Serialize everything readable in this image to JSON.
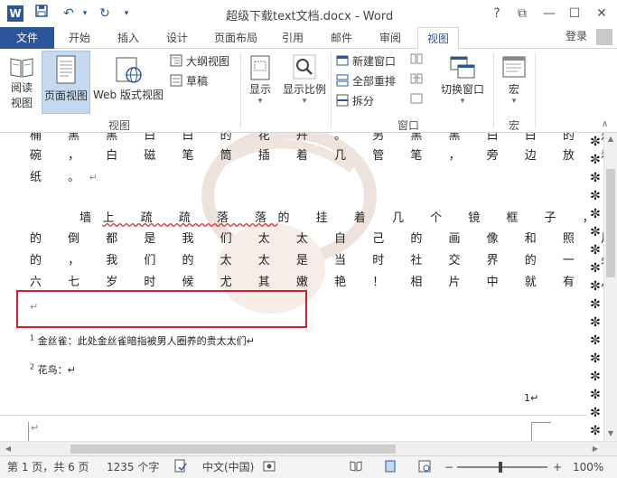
{
  "titlebar": {
    "title": "超级下载text文档.docx - Word",
    "app_icon": "W",
    "help": "?",
    "restore": "⧉",
    "minimize": "—",
    "maximize": "☐",
    "close": "✕"
  },
  "tabs": {
    "file": "文件",
    "items": [
      "开始",
      "插入",
      "设计",
      "页面布局",
      "引用",
      "邮件",
      "审阅",
      "视图"
    ],
    "active": "视图",
    "login": "登录"
  },
  "ribbon": {
    "views": {
      "read_mode_l1": "阅读",
      "read_mode_l2": "视图",
      "print_layout": "页面视图",
      "web_layout": "Web 版式视图",
      "outline": "大纲视图",
      "draft": "草稿",
      "group_label": "视图"
    },
    "show": {
      "label": "显示"
    },
    "zoom": {
      "label": "显示比例"
    },
    "window": {
      "new_window": "新建窗口",
      "arrange_all": "全部重排",
      "split": "拆分",
      "switch_windows": "切换窗口",
      "group_label": "窗口"
    },
    "macros": {
      "label": "宏",
      "group_label": "宏"
    }
  },
  "document": {
    "line_top": "桶 黑 黑 白 白 的 花 卉 。 另 黑 黑 白 白 的 是 一 只 大 墨",
    "line1": "碗 ， 白 磁 笔 筒 插 着 几 管 笔 ， 旁 边 放 着 几 卷 白",
    "line2": "纸 。",
    "para2_prefix": "墙",
    "para2_squig1": "上 疏 疏 落 落",
    "para2_rest": "的 挂 着 几 个 镜 框 子 ， 大 多 数",
    "line3": "的 倒 都 是 我 们 太 太 自 己 的 画 像 和 照 片 。 无 疑",
    "line4": "的 ， 我 们 的 太 太 是 当 时 社 交 界 的 一 朵 名 花 ， 十",
    "line5": "六 七 岁 时 候 尤 其 嫩 艳 ！ 相 片 中 就 有  几 张 是 青 春",
    "pmark": "↵",
    "footnote1_num": "1",
    "footnote1": "金丝雀：此处金丝雀暗指被男人圈养的贵太太们↵",
    "footnote2_num": "2",
    "footnote2": "花鸟：↵",
    "page_num": "1↵"
  },
  "statusbar": {
    "page": "第 1 页，共 6 页",
    "words": "1235 个字",
    "language": "中文(中国)",
    "zoom_out": "−",
    "zoom_in": "+",
    "zoom": "100%"
  },
  "colors": {
    "accent": "#2b579a",
    "highlight_box": "#d0202a",
    "active_ribbon_btn": "#c5daf0"
  }
}
